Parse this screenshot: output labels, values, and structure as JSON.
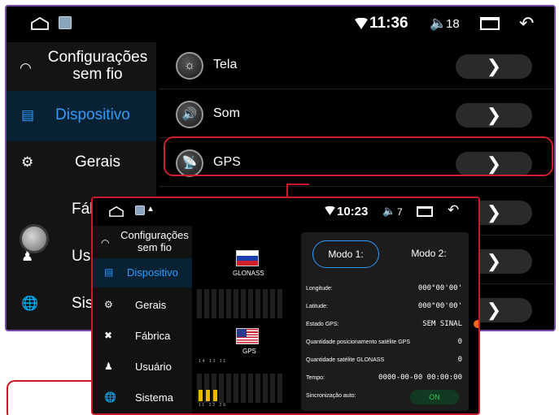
{
  "back": {
    "status": {
      "time": "11:36",
      "volume": "18"
    },
    "sidebar": [
      {
        "label": "Configurações sem fio",
        "icon": "wifi-icon"
      },
      {
        "label": "Dispositivo",
        "icon": "monitor-icon"
      },
      {
        "label": "Gerais",
        "icon": "gear-icon"
      },
      {
        "label": "Fáb",
        "icon": "wrench-icon"
      },
      {
        "label": "Usu",
        "icon": "user-icon"
      },
      {
        "label": "Sist",
        "icon": "globe-icon"
      }
    ],
    "list": [
      {
        "label": "Tela",
        "icon": "brightness-icon"
      },
      {
        "label": "Som",
        "icon": "speaker-icon"
      },
      {
        "label": "GPS",
        "icon": "satellite-icon"
      }
    ]
  },
  "front": {
    "status": {
      "time": "10:23",
      "volume": "7"
    },
    "sidebar": [
      {
        "label": "Configurações sem fio",
        "icon": "wifi-icon"
      },
      {
        "label": "Dispositivo",
        "icon": "monitor-icon"
      },
      {
        "label": "Gerais",
        "icon": "gear-icon"
      },
      {
        "label": "Fábrica",
        "icon": "wrench-icon"
      },
      {
        "label": "Usuário",
        "icon": "user-icon"
      },
      {
        "label": "Sistema",
        "icon": "globe-icon"
      }
    ],
    "satellites": {
      "glonass_label": "GLONASS",
      "gps_label": "GPS",
      "ids_top": "14 13 11",
      "ids_bottom": "11 22 26"
    },
    "gps_info": {
      "mode1": "Modo 1:",
      "mode2": "Modo 2:",
      "rows": [
        {
          "key": "Longitude:",
          "value": "000°00'00'"
        },
        {
          "key": "Latitude:",
          "value": "000°00'00'"
        },
        {
          "key": "Estado GPS:",
          "value": "SEM SINAL"
        },
        {
          "key": "Quantidade posicionamento satélite GPS",
          "value": "0"
        },
        {
          "key": "Quantidade satélite GLONASS",
          "value": "0"
        },
        {
          "key": "Tempo:",
          "value": "0000-00-00 00:00:00"
        }
      ],
      "sync_label": "Sincronização auto:",
      "sync_value": "ON"
    }
  },
  "colors": {
    "accent": "#2f9bff",
    "highlight": "#d01f2e",
    "frame": "#7a4aa8",
    "toggle_on": "#34c759"
  }
}
